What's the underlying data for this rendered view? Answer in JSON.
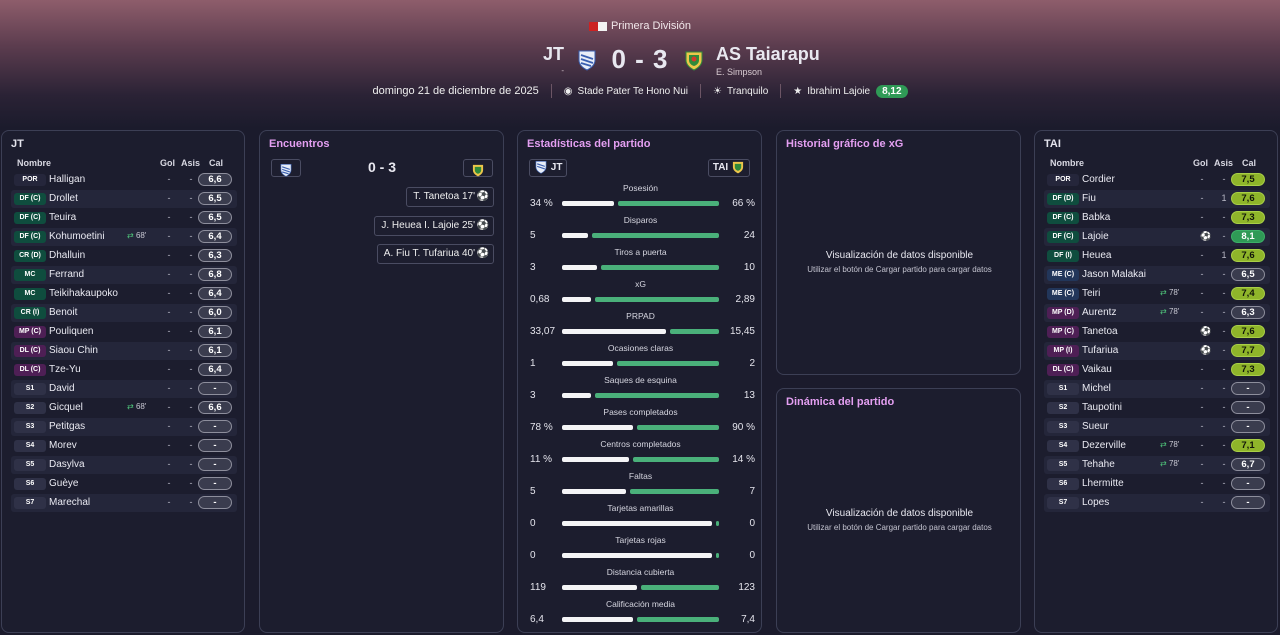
{
  "header": {
    "competition": "Primera División",
    "home_team": "JT",
    "home_sub": "-",
    "score": "0 - 3",
    "away_team": "AS Taiarapu",
    "away_sub": "E. Simpson",
    "date": "domingo 21 de diciembre de 2025",
    "stadium": "Stade Pater Te Hono Nui",
    "weather": "Tranquilo",
    "motm_name": "Ibrahim Lajoie",
    "motm_rating": "8,12"
  },
  "colors": {
    "accent_pink": "#e49ff2",
    "rating_green": "#8fb52a",
    "motm_green": "#2f9a56",
    "bar_green": "#4ab07a"
  },
  "home_panel": {
    "title": "JT",
    "col_name": "Nombre",
    "col_goals": "Gol",
    "col_assists": "Asis",
    "col_rating": "Cal",
    "players": [
      {
        "pos": "POR",
        "name": "Halligan",
        "goals": "-",
        "assists": "-",
        "rating": "6,6"
      },
      {
        "pos": "DF (C)",
        "name": "Drollet",
        "goals": "-",
        "assists": "-",
        "rating": "6,5"
      },
      {
        "pos": "DF (C)",
        "name": "Teuira",
        "goals": "-",
        "assists": "-",
        "rating": "6,5"
      },
      {
        "pos": "DF (C)",
        "name": "Kohumoetini",
        "sub": "68'",
        "goals": "-",
        "assists": "-",
        "rating": "6,4"
      },
      {
        "pos": "CR (D)",
        "name": "Dhalluin",
        "goals": "-",
        "assists": "-",
        "rating": "6,3"
      },
      {
        "pos": "MC",
        "name": "Ferrand",
        "goals": "-",
        "assists": "-",
        "rating": "6,8"
      },
      {
        "pos": "MC",
        "name": "Teikihakaupoko",
        "goals": "-",
        "assists": "-",
        "rating": "6,4"
      },
      {
        "pos": "CR (I)",
        "name": "Benoit",
        "goals": "-",
        "assists": "-",
        "rating": "6,0"
      },
      {
        "pos": "MP (C)",
        "name": "Pouliquen",
        "goals": "-",
        "assists": "-",
        "rating": "6,1"
      },
      {
        "pos": "DL (C)",
        "name": "Siaou Chin",
        "goals": "-",
        "assists": "-",
        "rating": "6,1"
      },
      {
        "pos": "DL (C)",
        "name": "Tze-Yu",
        "goals": "-",
        "assists": "-",
        "rating": "6,4"
      },
      {
        "pos": "S1",
        "name": "David",
        "goals": "-",
        "assists": "-",
        "rating": "-"
      },
      {
        "pos": "S2",
        "name": "Gicquel",
        "sub": "68'",
        "goals": "-",
        "assists": "-",
        "rating": "6,6"
      },
      {
        "pos": "S3",
        "name": "Petitgas",
        "goals": "-",
        "assists": "-",
        "rating": "-"
      },
      {
        "pos": "S4",
        "name": "Morev",
        "goals": "-",
        "assists": "-",
        "rating": "-"
      },
      {
        "pos": "S5",
        "name": "Dasylva",
        "goals": "-",
        "assists": "-",
        "rating": "-"
      },
      {
        "pos": "S6",
        "name": "Guèye",
        "goals": "-",
        "assists": "-",
        "rating": "-"
      },
      {
        "pos": "S7",
        "name": "Marechal",
        "goals": "-",
        "assists": "-",
        "rating": "-"
      }
    ]
  },
  "encounters": {
    "title": "Encuentros",
    "score": "0 - 3",
    "events": [
      {
        "text": "T. Tanetoa 17'"
      },
      {
        "text": "J. Heuea  I. Lajoie 25'"
      },
      {
        "text": "A. Fiu  T. Tufariua 40'"
      }
    ]
  },
  "stats": {
    "title": "Estadísticas del partido",
    "home_abbr": "JT",
    "away_abbr": "TAI",
    "rows": [
      {
        "label": "Posesión",
        "home": "34 %",
        "away": "66 %",
        "home_val": 34,
        "away_val": 66
      },
      {
        "label": "Disparos",
        "home": "5",
        "away": "24",
        "home_val": 5,
        "away_val": 24
      },
      {
        "label": "Tiros a puerta",
        "home": "3",
        "away": "10",
        "home_val": 3,
        "away_val": 10
      },
      {
        "label": "xG",
        "home": "0,68",
        "away": "2,89",
        "home_val": 0.68,
        "away_val": 2.89
      },
      {
        "label": "PRPAD",
        "home": "33,07",
        "away": "15,45",
        "home_val": 33.07,
        "away_val": 15.45
      },
      {
        "label": "Ocasiones claras",
        "home": "1",
        "away": "2",
        "home_val": 1,
        "away_val": 2
      },
      {
        "label": "Saques de esquina",
        "home": "3",
        "away": "13",
        "home_val": 3,
        "away_val": 13
      },
      {
        "label": "Pases completados",
        "home": "78 %",
        "away": "90 %",
        "home_val": 78,
        "away_val": 90
      },
      {
        "label": "Centros completados",
        "home": "11 %",
        "away": "14 %",
        "home_val": 11,
        "away_val": 14
      },
      {
        "label": "Faltas",
        "home": "5",
        "away": "7",
        "home_val": 5,
        "away_val": 7
      },
      {
        "label": "Tarjetas amarillas",
        "home": "0",
        "away": "0",
        "home_val": 0,
        "away_val": 0
      },
      {
        "label": "Tarjetas rojas",
        "home": "0",
        "away": "0",
        "home_val": 0,
        "away_val": 0
      },
      {
        "label": "Distancia cubierta",
        "home": "119",
        "away": "123",
        "home_val": 119,
        "away_val": 123
      },
      {
        "label": "Calificación media",
        "home": "6,4",
        "away": "7,4",
        "home_val": 6.4,
        "away_val": 7.4
      }
    ]
  },
  "xg_panel": {
    "title": "Historial gráfico de xG",
    "msg1": "Visualización de datos disponible",
    "msg2": "Utilizar el botón de Cargar partido para cargar datos"
  },
  "dyn_panel": {
    "title": "Dinámica del partido",
    "msg1": "Visualización de datos disponible",
    "msg2": "Utilizar el botón de Cargar partido para cargar datos"
  },
  "away_panel": {
    "title": "TAI",
    "col_name": "Nombre",
    "col_goals": "Gol",
    "col_assists": "Asis",
    "col_rating": "Cal",
    "players": [
      {
        "pos": "POR",
        "name": "Cordier",
        "goals": "-",
        "assists": "-",
        "rating": "7,5"
      },
      {
        "pos": "DF (D)",
        "name": "Fiu",
        "goals": "-",
        "assists": "1",
        "rating": "7,6"
      },
      {
        "pos": "DF (C)",
        "name": "Babka",
        "goals": "-",
        "assists": "-",
        "rating": "7,3"
      },
      {
        "pos": "DF (C)",
        "name": "Lajoie",
        "goal_icon": true,
        "goals": "",
        "assists": "-",
        "rating": "8,1"
      },
      {
        "pos": "DF (I)",
        "name": "Heuea",
        "goals": "-",
        "assists": "1",
        "rating": "7,6"
      },
      {
        "pos": "ME (C)",
        "name": "Jason Malakai",
        "goals": "-",
        "assists": "-",
        "rating": "6,5"
      },
      {
        "pos": "ME (C)",
        "name": "Teiri",
        "sub": "78'",
        "goals": "-",
        "assists": "-",
        "rating": "7,4"
      },
      {
        "pos": "MP (D)",
        "name": "Aurentz",
        "sub": "78'",
        "goals": "-",
        "assists": "-",
        "rating": "6,3"
      },
      {
        "pos": "MP (C)",
        "name": "Tanetoa",
        "goal_icon": true,
        "goals": "",
        "assists": "-",
        "rating": "7,6"
      },
      {
        "pos": "MP (I)",
        "name": "Tufariua",
        "goal_icon": true,
        "goals": "",
        "assists": "-",
        "rating": "7,7"
      },
      {
        "pos": "DL (C)",
        "name": "Vaikau",
        "goals": "-",
        "assists": "-",
        "rating": "7,3"
      },
      {
        "pos": "S1",
        "name": "Michel",
        "goals": "-",
        "assists": "-",
        "rating": "-"
      },
      {
        "pos": "S2",
        "name": "Taupotini",
        "goals": "-",
        "assists": "-",
        "rating": "-"
      },
      {
        "pos": "S3",
        "name": "Sueur",
        "goals": "-",
        "assists": "-",
        "rating": "-"
      },
      {
        "pos": "S4",
        "name": "Dezerville",
        "sub": "78'",
        "goals": "-",
        "assists": "-",
        "rating": "7,1"
      },
      {
        "pos": "S5",
        "name": "Tehahe",
        "sub": "78'",
        "goals": "-",
        "assists": "-",
        "rating": "6,7"
      },
      {
        "pos": "S6",
        "name": "Lhermitte",
        "goals": "-",
        "assists": "-",
        "rating": "-"
      },
      {
        "pos": "S7",
        "name": "Lopes",
        "goals": "-",
        "assists": "-",
        "rating": "-"
      }
    ]
  }
}
